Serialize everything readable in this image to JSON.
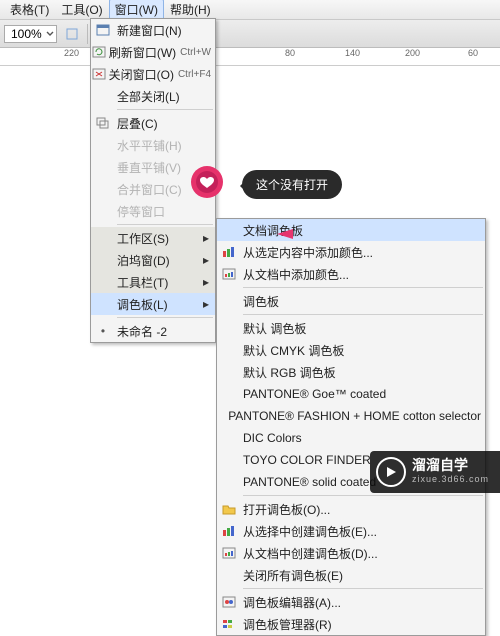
{
  "menubar": {
    "table": "表格(T)",
    "tools": "工具(O)",
    "window": "窗口(W)",
    "help": "帮助(H)"
  },
  "zoom": {
    "value": "100%"
  },
  "tabs": {
    "doc": "未命名 -2"
  },
  "ruler": {
    "t0": "220",
    "t1": "80",
    "t2": "140",
    "t3": "200",
    "t4": "60"
  },
  "windowMenu": {
    "newWindow": "新建窗口(N)",
    "refresh": "刷新窗口(W)",
    "refresh_short": "Ctrl+W",
    "close": "关闭窗口(O)",
    "close_short": "Ctrl+F4",
    "closeAll": "全部关闭(L)",
    "cascade": "层叠(C)",
    "hTile": "水平平铺(H)",
    "vTile": "垂直平铺(V)",
    "combine": "合并窗口(C)",
    "stopCombine": "停等窗口",
    "workspace": "工作区(S)",
    "dock": "泊坞窗(D)",
    "toolbar": "工具栏(T)",
    "palette": "调色板(L)",
    "docItem": "未命名 -2"
  },
  "paletteMenu": {
    "docPalette": "文档调色板",
    "addFromSel": "从选定内容中添加颜色...",
    "addFromDoc": "从文档中添加颜色...",
    "palette": "调色板",
    "default": "默认 调色板",
    "cmyk": "默认 CMYK 调色板",
    "rgb": "默认 RGB 调色板",
    "goe": "PANTONE® Goe™ coated",
    "fashion": "PANTONE® FASHION + HOME cotton selector",
    "dic": "DIC Colors",
    "toyo": "TOYO COLOR FINDER",
    "solid": "PANTONE® solid coated",
    "open": "打开调色板(O)...",
    "fromSel": "从选择中创建调色板(E)...",
    "fromDoc": "从文档中创建调色板(D)...",
    "closeAll": "关闭所有调色板(E)",
    "editor": "调色板编辑器(A)...",
    "manager": "调色板管理器(R)"
  },
  "callout": {
    "text": "这个没有打开"
  },
  "watermark": {
    "brand": "溜溜自学",
    "url": "zixue.3d66.com"
  }
}
